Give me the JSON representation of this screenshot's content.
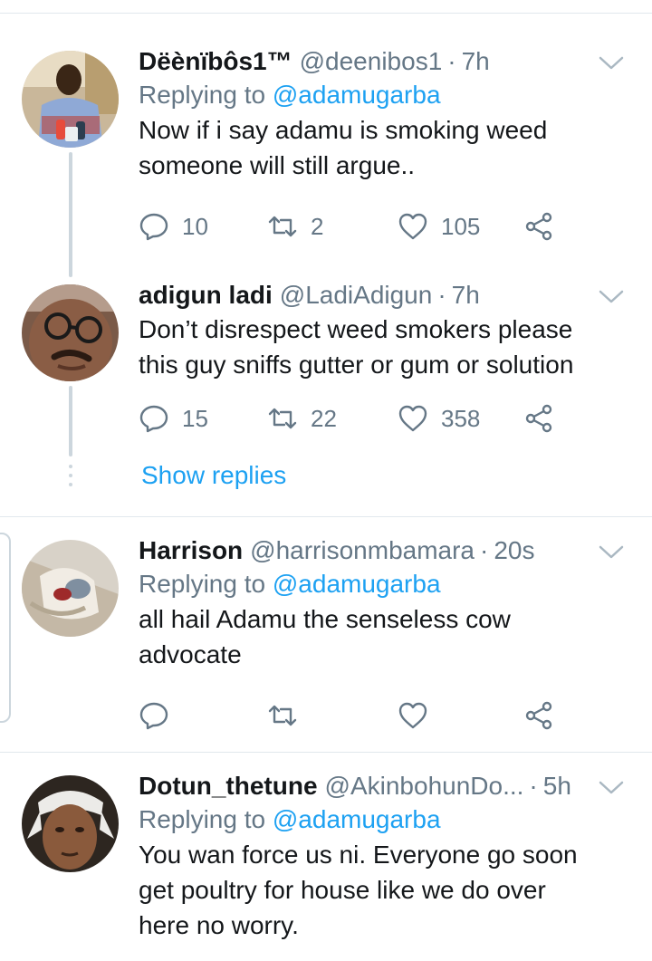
{
  "tweets": [
    {
      "name": "Dëènïbôs1™",
      "handle": "@deenibos1",
      "dot": "·",
      "time": "7h",
      "replying_prefix": "Replying to",
      "replying_to": "@adamugarba",
      "text_lines": [
        "Now if i say adamu is smoking weed",
        "someone will still argue.."
      ],
      "replies": "10",
      "retweets": "2",
      "likes": "105"
    },
    {
      "name": "adigun ladi",
      "handle": "@LadiAdigun",
      "dot": "·",
      "time": "7h",
      "text_lines": [
        "Don’t disrespect weed smokers please",
        "this guy sniffs gutter or gum or solution"
      ],
      "replies": "15",
      "retweets": "22",
      "likes": "358"
    },
    {
      "name": "Harrison",
      "handle": "@harrisonmbamara",
      "dot": "·",
      "time": "20s",
      "replying_prefix": "Replying to",
      "replying_to": "@adamugarba",
      "text_lines": [
        "all hail Adamu the senseless cow",
        "advocate"
      ]
    },
    {
      "name": "Dotun_thetune",
      "handle": "@AkinbohunDo...",
      "dot": "·",
      "time": "5h",
      "replying_prefix": "Replying to",
      "replying_to": "@adamugarba",
      "text_lines": [
        "You wan force us ni. Everyone go soon",
        "get poultry for house like we do over",
        "here no worry."
      ]
    }
  ],
  "thread": {
    "show_replies": "Show replies"
  },
  "icons": {
    "reply": "reply-icon",
    "retweet": "retweet-icon",
    "like": "heart-icon",
    "share": "share-icon",
    "caret": "chevron-down-icon"
  },
  "colors": {
    "link": "#1da1f2",
    "secondary_text": "#657786",
    "divider": "#e1e8ed",
    "thread_line": "#ccd6dd"
  }
}
